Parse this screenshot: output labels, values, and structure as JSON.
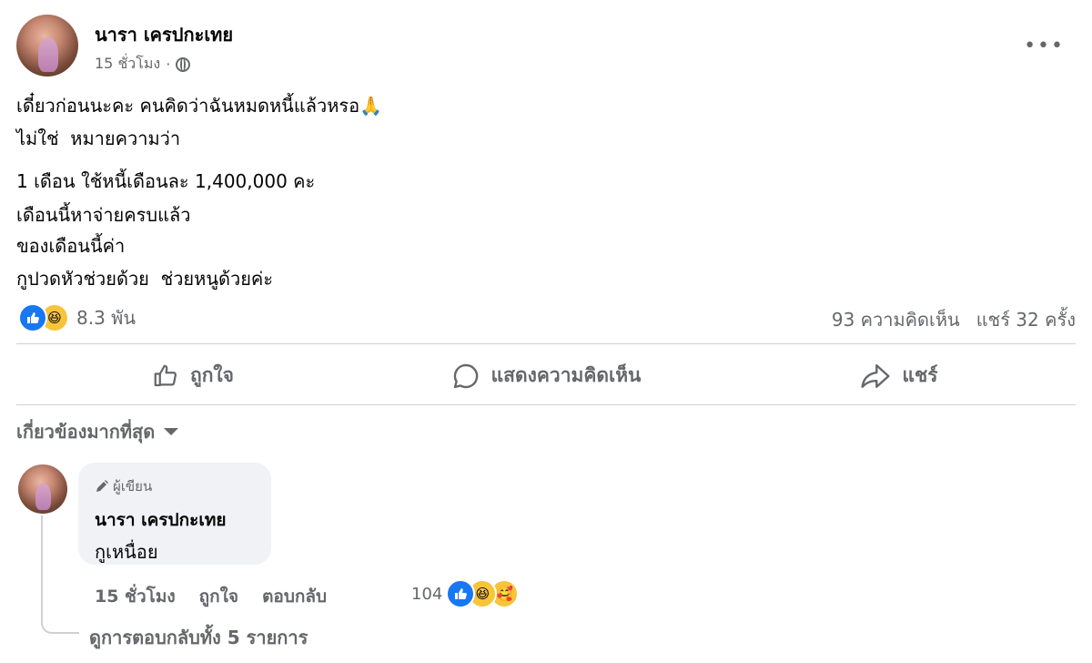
{
  "post": {
    "author": "นารา เครปกะเทย",
    "time": "15 ชั่วโมง",
    "privacy_icon": "globe-icon",
    "lines": [
      "เดี๋ยวก่อนนะคะ คนคิดว่าฉันหมดหนี้แล้วหรอ🙏",
      "ไม่ใช่  หมายความว่า",
      "1 เดือน ใช้หนี้เดือนละ 1,400,000 คะ",
      "เดือนนี้หาจ่ายครบแล้ว",
      "ของเดือนนี้ค่า",
      "กูปวดหัวช่วยด้วย  ช่วยหนูด้วยค่ะ"
    ]
  },
  "reactions": {
    "icons": [
      "like",
      "haha"
    ],
    "count": "8.3 พัน",
    "comments": "93 ความคิดเห็น",
    "shares": "แชร์ 32 ครั้ง"
  },
  "actions": {
    "like": "ถูกใจ",
    "comment": "แสดงความคิดเห็น",
    "share": "แชร์"
  },
  "filter": {
    "label": "เกี่ยวข้องมากที่สุด"
  },
  "comment": {
    "badge": "ผู้เขียน",
    "author": "นารา เครปกะเทย",
    "text": "กูเหนื่อย",
    "time": "15 ชั่วโมง",
    "like": "ถูกใจ",
    "reply": "ตอบกลับ",
    "reaction_count": "104",
    "reaction_icons": [
      "like",
      "haha",
      "care"
    ]
  },
  "view_replies": "ดูการตอบกลับทั้ง 5 รายการ",
  "colors": {
    "like_blue": "#1877f2",
    "secondary_text": "#65676b",
    "bubble_bg": "#f0f2f5"
  }
}
